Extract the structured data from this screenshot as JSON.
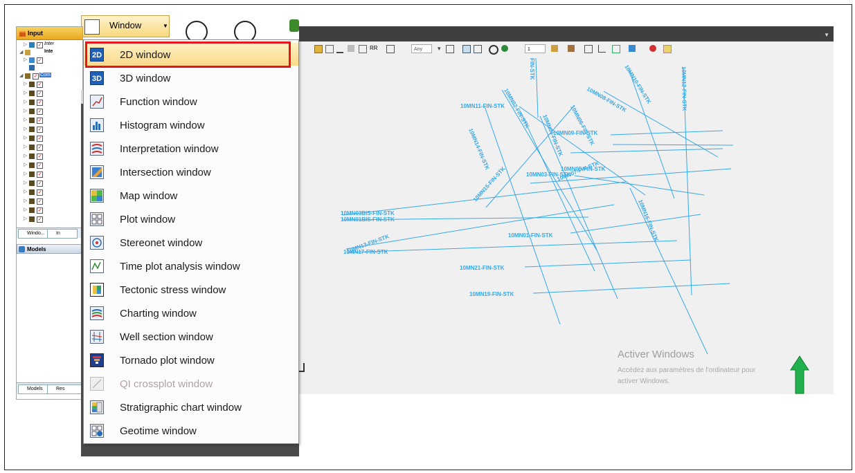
{
  "window_button": {
    "label": "Window"
  },
  "left_panel": {
    "input_title": "Input",
    "tree_item_1": "Inter",
    "tree_item_2": "Inte",
    "tree_item_3": "Com",
    "tabs_top": [
      "Windo...",
      "In"
    ],
    "models_title": "Models",
    "tabs_bottom": [
      "Models",
      "Res"
    ]
  },
  "menu": {
    "items": [
      {
        "label": "2D window",
        "icon": "2d-icon",
        "badge": "2D"
      },
      {
        "label": "3D window",
        "icon": "3d-icon",
        "badge": "3D"
      },
      {
        "label": "Function window",
        "icon": "function-icon"
      },
      {
        "label": "Histogram window",
        "icon": "histogram-icon"
      },
      {
        "label": "Interpretation window",
        "icon": "interpretation-icon"
      },
      {
        "label": "Intersection window",
        "icon": "intersection-icon"
      },
      {
        "label": "Map window",
        "icon": "map-icon"
      },
      {
        "label": "Plot window",
        "icon": "plot-icon"
      },
      {
        "label": "Stereonet window",
        "icon": "stereonet-icon"
      },
      {
        "label": "Time plot analysis window",
        "icon": "time-plot-icon"
      },
      {
        "label": "Tectonic stress window",
        "icon": "tectonic-stress-icon"
      },
      {
        "label": "Charting window",
        "icon": "charting-icon"
      },
      {
        "label": "Well section window",
        "icon": "well-section-icon"
      },
      {
        "label": "Tornado plot window",
        "icon": "tornado-icon"
      },
      {
        "label": "QI crossplot window",
        "icon": "qi-crossplot-icon",
        "disabled": true
      },
      {
        "label": "Stratigraphic chart window",
        "icon": "stratigraphic-icon"
      },
      {
        "label": "Geotime window",
        "icon": "geotime-icon"
      }
    ]
  },
  "toolbar": {
    "any": "Any",
    "zoom_value": "1"
  },
  "seismic_lines": [
    "FIN-STK",
    "10MN10-FIN-STK",
    "10MN12-FIN-STK",
    "10MN11-FIN-STK",
    "10MN02-FIN-STK",
    "10MN08-FIN-STK",
    "10MN09-FIN-STK",
    "10MN04-FIN-STK",
    "10MN06-FIN-STK",
    "10MN14-FIN-STK",
    "10MN05-FIN-STK",
    "10MN07-FIN-STK",
    "10MN15-FIN-STK",
    "10MN03-FIN-STK",
    "10MN03BIS-FIN-STK",
    "10MN01BIS-FIN-STK",
    "10MN16-FIN-STK",
    "10MN01-FIN-STK",
    "10MN13-FIN-STK",
    "10MN17-FIN-STK",
    "10MN21-FIN-STK",
    "10MN19-FIN-STK"
  ],
  "watermark": {
    "title": "Activer Windows",
    "line1": "Accédez aux paramètres de l'ordinateur pour",
    "line2": "activer Windows."
  },
  "colors": {
    "seismic": "#34a8e8",
    "highlight_border": "#e8141c",
    "north_arrow": "#22b14c"
  }
}
